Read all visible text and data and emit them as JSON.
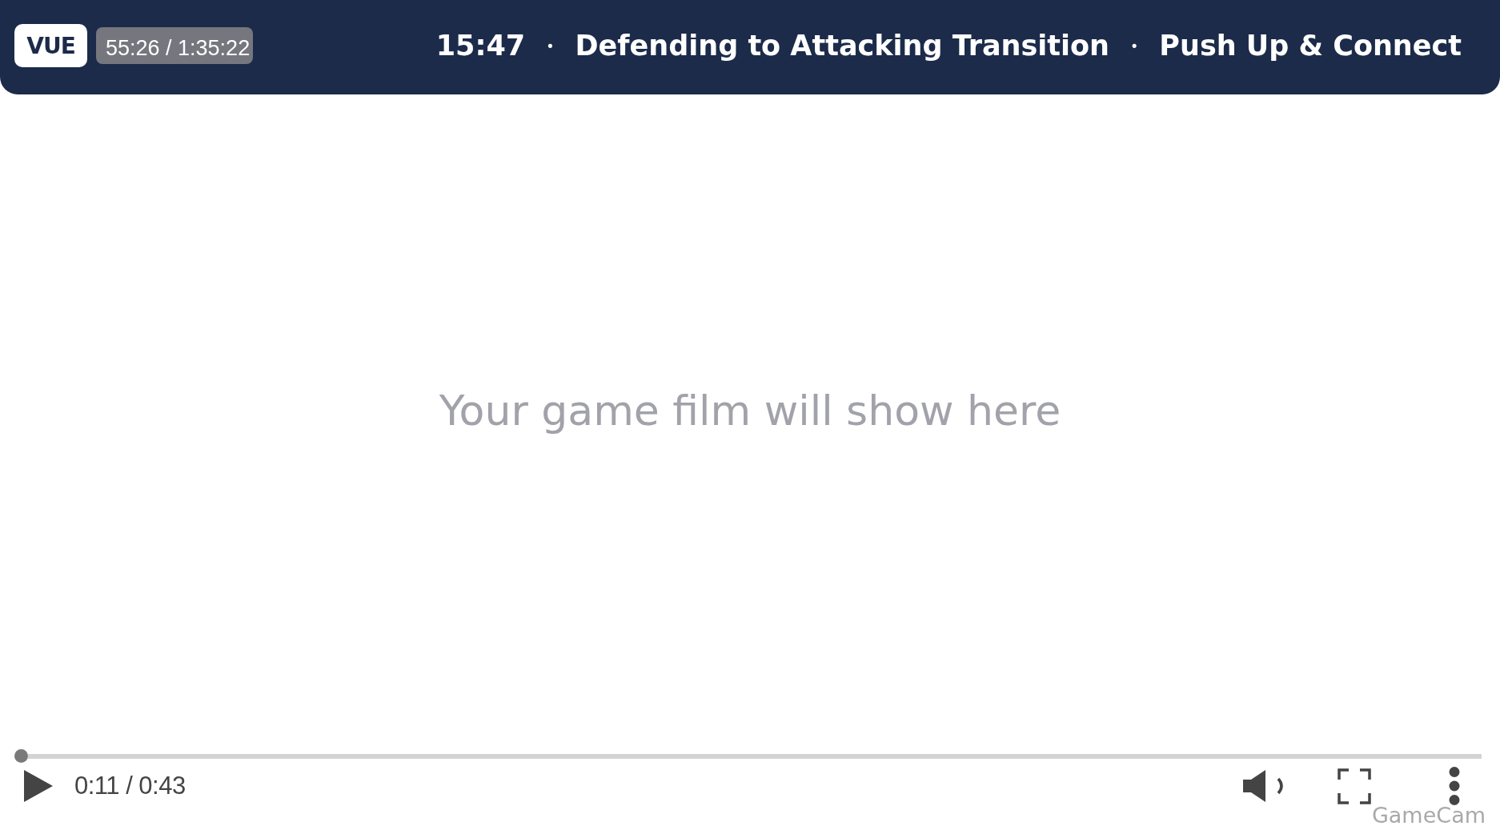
{
  "header": {
    "logo": "VUE",
    "timecode": "55:26 / 1:35:22",
    "title_segments": [
      {
        "kind": "text",
        "text": "15:47"
      },
      {
        "kind": "separator",
        "text": "•"
      },
      {
        "kind": "text",
        "text": "Defending to Attacking Transition"
      },
      {
        "kind": "separator",
        "text": "•"
      },
      {
        "kind": "text",
        "text": "Push Up & Connect"
      }
    ]
  },
  "video": {
    "message": "Your game film will show here"
  },
  "player": {
    "progress": {
      "level": 0
    },
    "playing": false,
    "time": "0:11 / 0:43",
    "muted": false,
    "brand": "GameCam"
  }
}
